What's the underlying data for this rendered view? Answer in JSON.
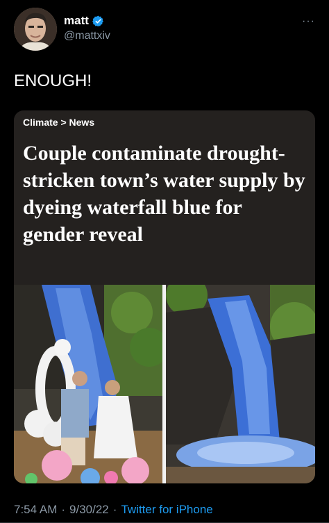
{
  "tweet": {
    "name": "matt",
    "handle": "@mattxiv",
    "text": "ENOUGH!",
    "more": "···",
    "time": "7:54 AM",
    "date": "9/30/22",
    "source": "Twitter for iPhone",
    "separator": "·"
  },
  "card": {
    "breadcrumb": "Climate > News",
    "headline": "Couple contaminate drought-stricken town’s water supply by dyeing waterfall blue for gender reveal"
  },
  "colors": {
    "background": "#000000",
    "card": "#24211f",
    "link": "#1d9bf0",
    "muted": "#8b98a5",
    "verified": "#1d9bf0"
  },
  "icons": {
    "verified": "verified-badge-icon",
    "more": "more-dots-icon"
  }
}
